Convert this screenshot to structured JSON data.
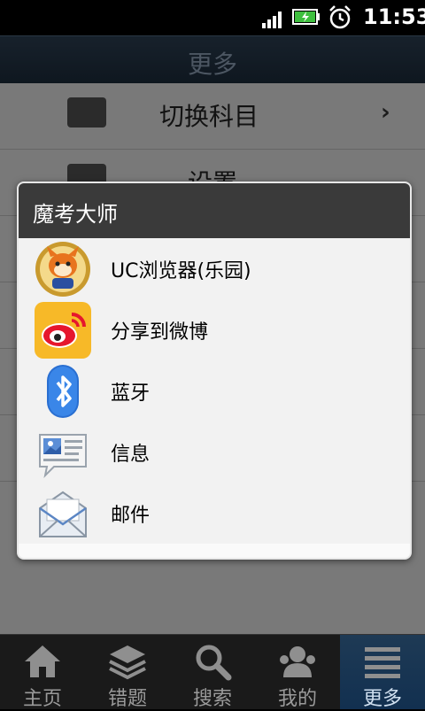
{
  "status_bar": {
    "time": "11:53"
  },
  "header": {
    "title": "更多"
  },
  "menu": {
    "items": [
      {
        "label": "切换科目",
        "icon": "switch-icon"
      },
      {
        "label": "设置",
        "icon": "settings-icon"
      }
    ]
  },
  "dialog": {
    "title": "魔考大师",
    "options": [
      {
        "label": "UC浏览器(乐园)",
        "icon": "uc-browser-icon"
      },
      {
        "label": "分享到微博",
        "icon": "weibo-icon"
      },
      {
        "label": "蓝牙",
        "icon": "bluetooth-icon"
      },
      {
        "label": "信息",
        "icon": "messaging-icon"
      },
      {
        "label": "邮件",
        "icon": "email-icon"
      }
    ]
  },
  "tab_bar": {
    "tabs": [
      {
        "label": "主页",
        "icon": "home-icon"
      },
      {
        "label": "错题",
        "icon": "stack-icon"
      },
      {
        "label": "搜索",
        "icon": "search-icon"
      },
      {
        "label": "我的",
        "icon": "people-icon"
      },
      {
        "label": "更多",
        "icon": "list-icon"
      }
    ],
    "active_tab": "更多"
  },
  "colors": {
    "header_bg": "#1b2a39",
    "dialog_header_bg": "#3a3a3a",
    "tab_active_bg": "#123050"
  }
}
